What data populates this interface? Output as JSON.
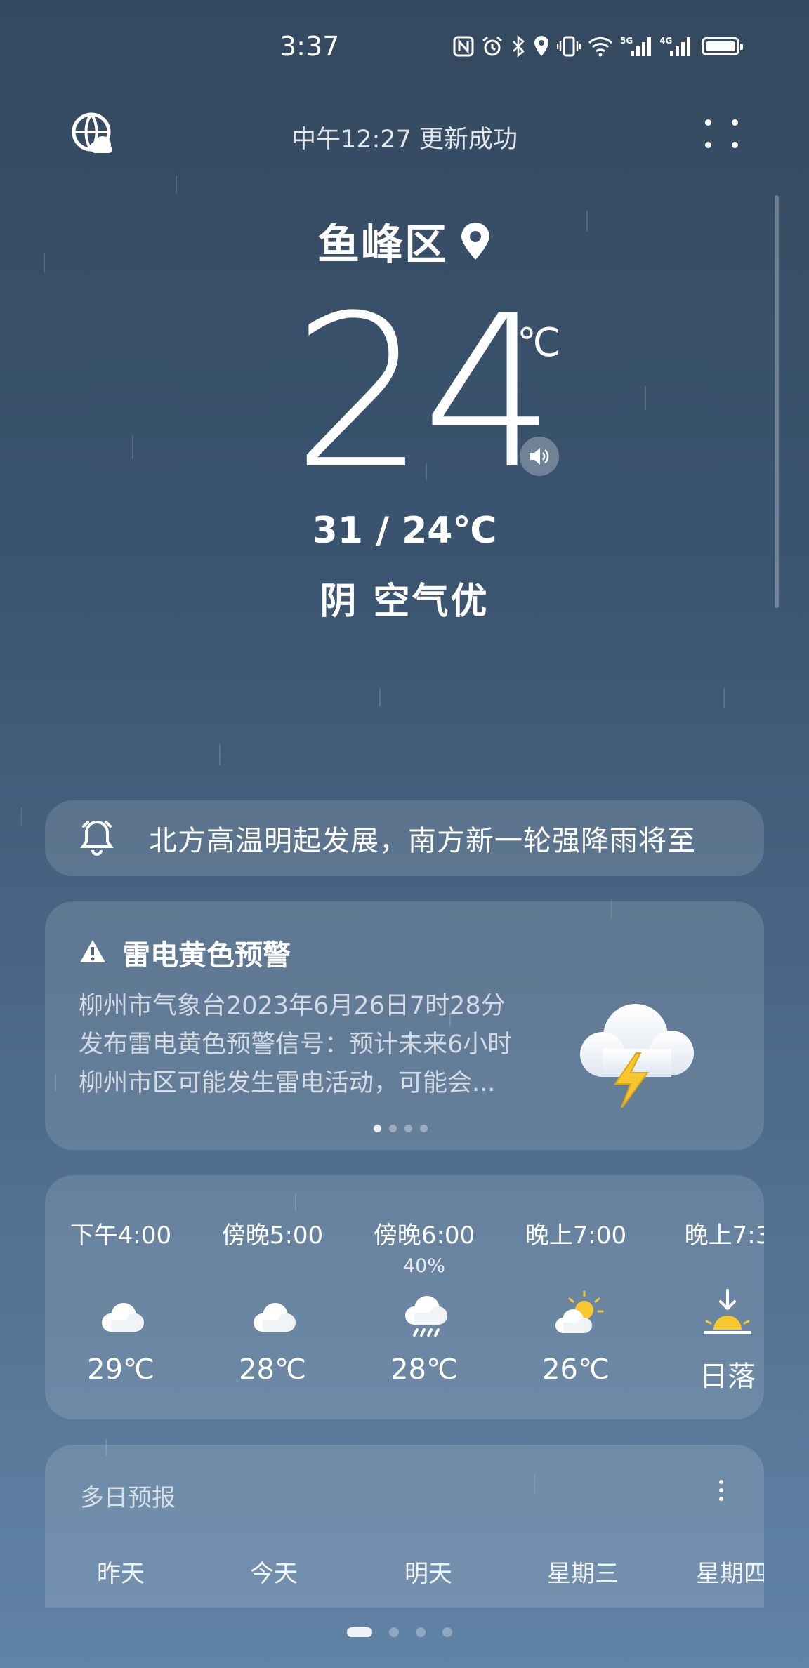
{
  "status_bar": {
    "time": "3:37",
    "network_1": "5G",
    "network_2": "4G",
    "icons": [
      "nfc-icon",
      "alarm-icon",
      "bluetooth-icon",
      "location-icon",
      "vibrate-icon",
      "wifi-icon",
      "signal-icon",
      "signal-icon",
      "battery-icon"
    ]
  },
  "header": {
    "update_status": "中午12:27 更新成功",
    "left_icon": "globe-cloud-icon",
    "right_icon": "more-icon"
  },
  "current": {
    "location": "鱼峰区",
    "temperature": "24",
    "unit": "℃",
    "high_low": "31 / 24℃",
    "condition": "阴  空气优"
  },
  "news": {
    "text": "北方高温明起发展，南方新一轮强降雨将至"
  },
  "alert": {
    "title": "雷电黄色预警",
    "lines": [
      "柳州市气象台2023年6月26日7时28分",
      "发布雷电黄色预警信号：预计未来6小时",
      "柳州市区可能发生雷电活动，可能会..."
    ],
    "page_count": 4,
    "active_page": 0
  },
  "hourly": [
    {
      "time": "下午4:00",
      "pop": "",
      "icon": "cloudy-icon",
      "temp": "29℃"
    },
    {
      "time": "傍晚5:00",
      "pop": "",
      "icon": "cloudy-icon",
      "temp": "28℃"
    },
    {
      "time": "傍晚6:00",
      "pop": "40%",
      "icon": "rain-icon",
      "temp": "28℃"
    },
    {
      "time": "晚上7:00",
      "pop": "",
      "icon": "partly-sunny-icon",
      "temp": "26℃"
    },
    {
      "time": "晚上7:3",
      "pop": "",
      "icon": "sunset-icon",
      "temp": "日落"
    }
  ],
  "daily": {
    "title": "多日预报",
    "days": [
      "昨天",
      "今天",
      "明天",
      "星期三",
      "星期四"
    ]
  },
  "page_indicator": {
    "count": 4,
    "active": 0
  },
  "colors": {
    "bg_top": "#34495f",
    "bg_bottom": "#6183a6",
    "warning_yellow": "#f6c72e"
  }
}
